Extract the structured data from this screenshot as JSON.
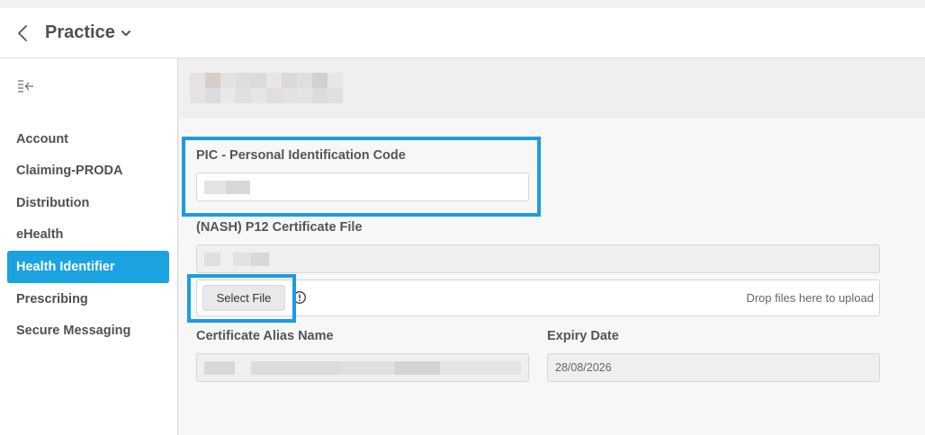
{
  "header": {
    "title": "Practice"
  },
  "sidebar": {
    "items": [
      {
        "label": "Account"
      },
      {
        "label": "Claiming-PRODA"
      },
      {
        "label": "Distribution"
      },
      {
        "label": "eHealth"
      },
      {
        "label": "Health Identifier",
        "active": true
      },
      {
        "label": "Prescribing"
      },
      {
        "label": "Secure Messaging"
      }
    ]
  },
  "form": {
    "pic_label": "PIC - Personal Identification Code",
    "cert_file_label": "(NASH) P12 Certificate File",
    "select_file_label": "Select File",
    "drop_text": "Drop files here to upload",
    "alias_label": "Certificate Alias Name",
    "expiry_label": "Expiry Date",
    "expiry_value": "28/08/2026"
  },
  "colors": {
    "accent": "#1aa3e0",
    "highlight_border": "#1e9be0"
  },
  "icons": {
    "back": "chevron-left-icon",
    "title_dropdown": "chevron-down-icon",
    "collapse": "collapse-sidebar-icon",
    "info": "exclamation-circle-icon"
  }
}
